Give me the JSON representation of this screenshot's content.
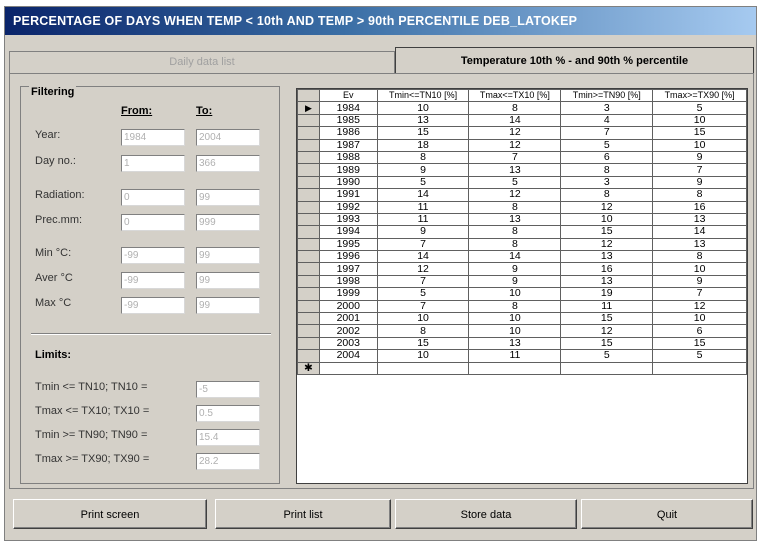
{
  "window": {
    "title": "PERCENTAGE OF DAYS WHEN TEMP < 10th AND TEMP > 90th PERCENTILE  DEB_LATOKEP"
  },
  "tabs": [
    {
      "label": "Daily data list",
      "active": false
    },
    {
      "label": "Temperature 10th %  -  and 90th %   percentile",
      "active": true
    }
  ],
  "filtering": {
    "title": "Filtering",
    "from_label": "From:",
    "to_label": "To:",
    "rows": [
      {
        "label": "Year:",
        "from": "1984",
        "to": "2004"
      },
      {
        "label": "Day no.:",
        "from": "1",
        "to": "366"
      },
      {
        "label": "Radiation:",
        "from": "0",
        "to": "99"
      },
      {
        "label": "Prec.mm:",
        "from": "0",
        "to": "999"
      },
      {
        "label": "Min  °C:",
        "from": "-99",
        "to": "99"
      },
      {
        "label": "Aver °C",
        "from": "-99",
        "to": "99"
      },
      {
        "label": "Max °C",
        "from": "-99",
        "to": "99"
      }
    ]
  },
  "limits": {
    "title": "Limits:",
    "rows": [
      {
        "label": "Tmin <= TN10;  TN10 =",
        "value": "-5"
      },
      {
        "label": "Tmax <= TX10;   TX10 =",
        "value": "0.5"
      },
      {
        "label": "Tmin >= TN90;  TN90 =",
        "value": "15.4"
      },
      {
        "label": "Tmax >= TX90;   TX90 =",
        "value": "28.2"
      }
    ]
  },
  "grid": {
    "columns": [
      "Ev",
      "Tmin<=TN10 [%]",
      "Tmax<=TX10 [%]",
      "Tmin>=TN90 [%]",
      "Tmax>=TX90 [%]"
    ],
    "current_row_marker": "▶",
    "new_row_marker": "✱",
    "rows": [
      [
        "1984",
        "10",
        "8",
        "3",
        "5"
      ],
      [
        "1985",
        "13",
        "14",
        "4",
        "10"
      ],
      [
        "1986",
        "15",
        "12",
        "7",
        "15"
      ],
      [
        "1987",
        "18",
        "12",
        "5",
        "10"
      ],
      [
        "1988",
        "8",
        "7",
        "6",
        "9"
      ],
      [
        "1989",
        "9",
        "13",
        "8",
        "7"
      ],
      [
        "1990",
        "5",
        "5",
        "3",
        "9"
      ],
      [
        "1991",
        "14",
        "12",
        "8",
        "8"
      ],
      [
        "1992",
        "11",
        "8",
        "12",
        "16"
      ],
      [
        "1993",
        "11",
        "13",
        "10",
        "13"
      ],
      [
        "1994",
        "9",
        "8",
        "15",
        "14"
      ],
      [
        "1995",
        "7",
        "8",
        "12",
        "13"
      ],
      [
        "1996",
        "14",
        "14",
        "13",
        "8"
      ],
      [
        "1997",
        "12",
        "9",
        "16",
        "10"
      ],
      [
        "1998",
        "7",
        "9",
        "13",
        "9"
      ],
      [
        "1999",
        "5",
        "10",
        "19",
        "7"
      ],
      [
        "2000",
        "7",
        "8",
        "11",
        "12"
      ],
      [
        "2001",
        "10",
        "10",
        "15",
        "10"
      ],
      [
        "2002",
        "8",
        "10",
        "12",
        "6"
      ],
      [
        "2003",
        "15",
        "13",
        "15",
        "15"
      ],
      [
        "2004",
        "10",
        "11",
        "5",
        "5"
      ]
    ]
  },
  "buttons": {
    "print_screen": "Print screen",
    "print_list": "Print list",
    "store_data": "Store data",
    "quit": "Quit"
  }
}
